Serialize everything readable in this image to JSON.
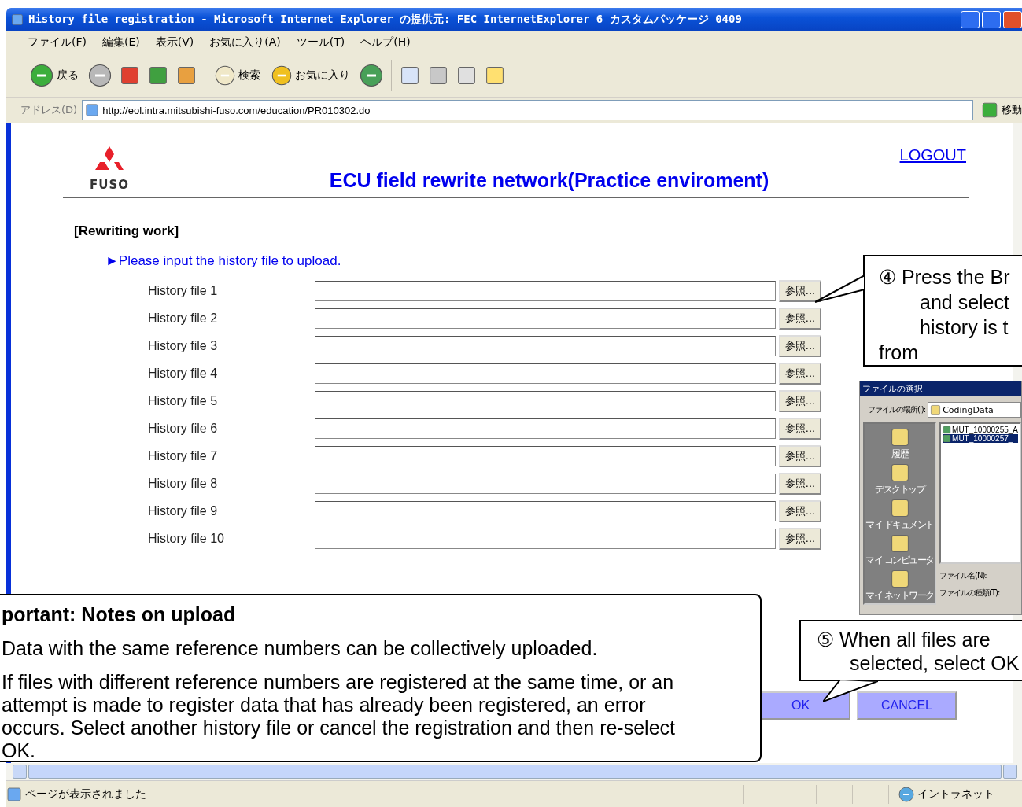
{
  "window": {
    "title": "History file registration - Microsoft Internet Explorer の提供元: FEC InternetExplorer 6 カスタムパッケージ 0409"
  },
  "menu": [
    "ファイル(F)",
    "編集(E)",
    "表示(V)",
    "お気に入り(A)",
    "ツール(T)",
    "ヘルプ(H)"
  ],
  "toolbar": {
    "back": "戻る",
    "search": "検索",
    "favorites": "お気に入り"
  },
  "address": {
    "label": "アドレス(D)",
    "url": "http://eol.intra.mitsubishi-fuso.com/education/PR010302.do",
    "go": "移動"
  },
  "page": {
    "brand": "FUSO",
    "title": "ECU field rewrite network(Practice enviroment)",
    "logout": "LOGOUT",
    "section": "[Rewriting work]",
    "instruction": "►Please input the history file to upload.",
    "files": [
      {
        "label": "History file 1",
        "button": "参照..."
      },
      {
        "label": "History file 2",
        "button": "参照..."
      },
      {
        "label": "History file 3",
        "button": "参照..."
      },
      {
        "label": "History file 4",
        "button": "参照..."
      },
      {
        "label": "History file 5",
        "button": "参照..."
      },
      {
        "label": "History file 6",
        "button": "参照..."
      },
      {
        "label": "History file 7",
        "button": "参照..."
      },
      {
        "label": "History file 8",
        "button": "参照..."
      },
      {
        "label": "History file 9",
        "button": "参照..."
      },
      {
        "label": "History file 10",
        "button": "参照..."
      }
    ],
    "ok": "OK",
    "cancel": "CANCEL"
  },
  "notes": {
    "title": "portant: Notes on upload",
    "lines": [
      "Data with the same reference numbers can be collectively uploaded."
    ],
    "paragraph": [
      "If files with different reference numbers are registered at the same time, or an",
      "attempt is made to register data that has already been registered, an error",
      "occurs.   Select another history file or cancel the registration and then re-select",
      "OK."
    ]
  },
  "callouts": [
    {
      "number": "④",
      "lines": [
        "Press the Br",
        "and select",
        "history is t",
        "from"
      ]
    },
    {
      "number": "⑤",
      "lines": [
        "When all files are",
        "selected, select OK"
      ]
    }
  ],
  "file_dialog": {
    "title": "ファイルの選択",
    "location_label": "ファイルの場所(I):",
    "location": "CodingData_",
    "places": [
      "履歴",
      "デスクトップ",
      "マイ ドキュメント",
      "マイ コンピュータ",
      "マイ ネットワーク"
    ],
    "files": [
      {
        "name": "MUT_10000255_A",
        "selected": false
      },
      {
        "name": "MUT_10000257_",
        "selected": true
      }
    ],
    "name_label": "ファイル名(N):",
    "type_label": "ファイルの種類(T):"
  },
  "status": {
    "text": "ページが表示されました",
    "zone": "イントラネット"
  }
}
